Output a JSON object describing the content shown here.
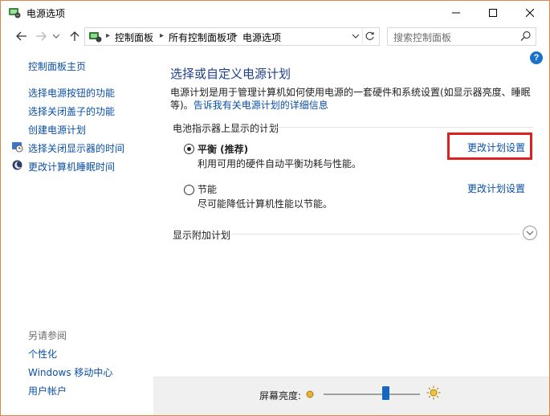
{
  "window": {
    "title": "电源选项"
  },
  "nav": {
    "breadcrumbs": [
      "控制面板",
      "所有控制面板项",
      "电源选项"
    ],
    "search_placeholder": "搜索控制面板"
  },
  "help": {
    "symbol": "?"
  },
  "sidebar": {
    "home": "控制面板主页",
    "links": [
      "选择电源按钮的功能",
      "选择关闭盖子的功能",
      "创建电源计划",
      "选择关闭显示器的时间",
      "更改计算机睡眠时间"
    ],
    "see_also_title": "另请参阅",
    "see_also": [
      "个性化",
      "Windows 移动中心",
      "用户帐户"
    ]
  },
  "main": {
    "heading": "选择或自定义电源计划",
    "description": "电源计划是用于管理计算机如何使用电源的一套硬件和系统设置(如显示器亮度、睡眠等)。",
    "description_link": "告诉我有关电源计划的详细信息",
    "group_label": "电池指示器上显示的计划",
    "plans": [
      {
        "name": "平衡 (推荐)",
        "description": "利用可用的硬件自动平衡功耗与性能。",
        "link": "更改计划设置",
        "selected": true
      },
      {
        "name": "节能",
        "description": "尽可能降低计算机性能以节能。",
        "link": "更改计划设置",
        "selected": false
      }
    ],
    "additional_plans_label": "显示附加计划"
  },
  "bottom": {
    "brightness_label": "屏幕亮度:",
    "brightness_level_percent": 64
  },
  "colors": {
    "link": "#0b4fa6",
    "heading": "#1e3f8a",
    "highlight": "#e02020",
    "window_border": "#e0854a"
  }
}
